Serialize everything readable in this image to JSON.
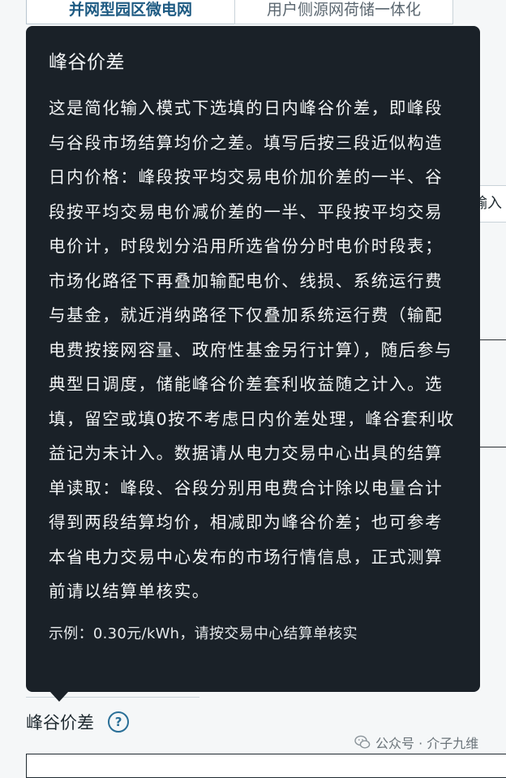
{
  "tabs": [
    {
      "label": "并网型园区微电网",
      "active": true
    },
    {
      "label": "用户侧源网荷储一体化",
      "active": false
    }
  ],
  "side_chip_label": "输入",
  "tooltip": {
    "title": "峰谷价差",
    "body": "这是简化输入模式下选填的日内峰谷价差，即峰段与谷段市场结算均价之差。填写后按三段近似构造日内价格：峰段按平均交易电价加价差的一半、谷段按平均交易电价减价差的一半、平段按平均交易电价计，时段划分沿用所选省份分时电价时段表；市场化路径下再叠加输配电价、线损、系统运行费与基金，就近消纳路径下仅叠加系统运行费（输配电费按接网容量、政府性基金另行计算），随后参与典型日调度，储能峰谷价差套利收益随之计入。选填，留空或填0按不考虑日内价差处理，峰谷套利收益记为未计入。数据请从电力交易中心出具的结算单读取：峰段、谷段分别用电费合计除以电量合计得到两段结算均价，相减即为峰谷价差；也可参考本省电力交易中心发布的市场行情信息，正式测算前请以结算单核实。",
    "example": "示例：0.30元/kWh，请按交易中心结算单核实"
  },
  "field": {
    "label": "峰谷价差",
    "help_icon": "question-circle-icon",
    "help_symbol": "?"
  },
  "watermark": {
    "text": "公众号 · 介子九维",
    "icon": "wechat-icon"
  },
  "colors": {
    "tooltip_bg": "#1a2128",
    "accent": "#2a6f97",
    "active_tab_text": "#1d5a82"
  }
}
